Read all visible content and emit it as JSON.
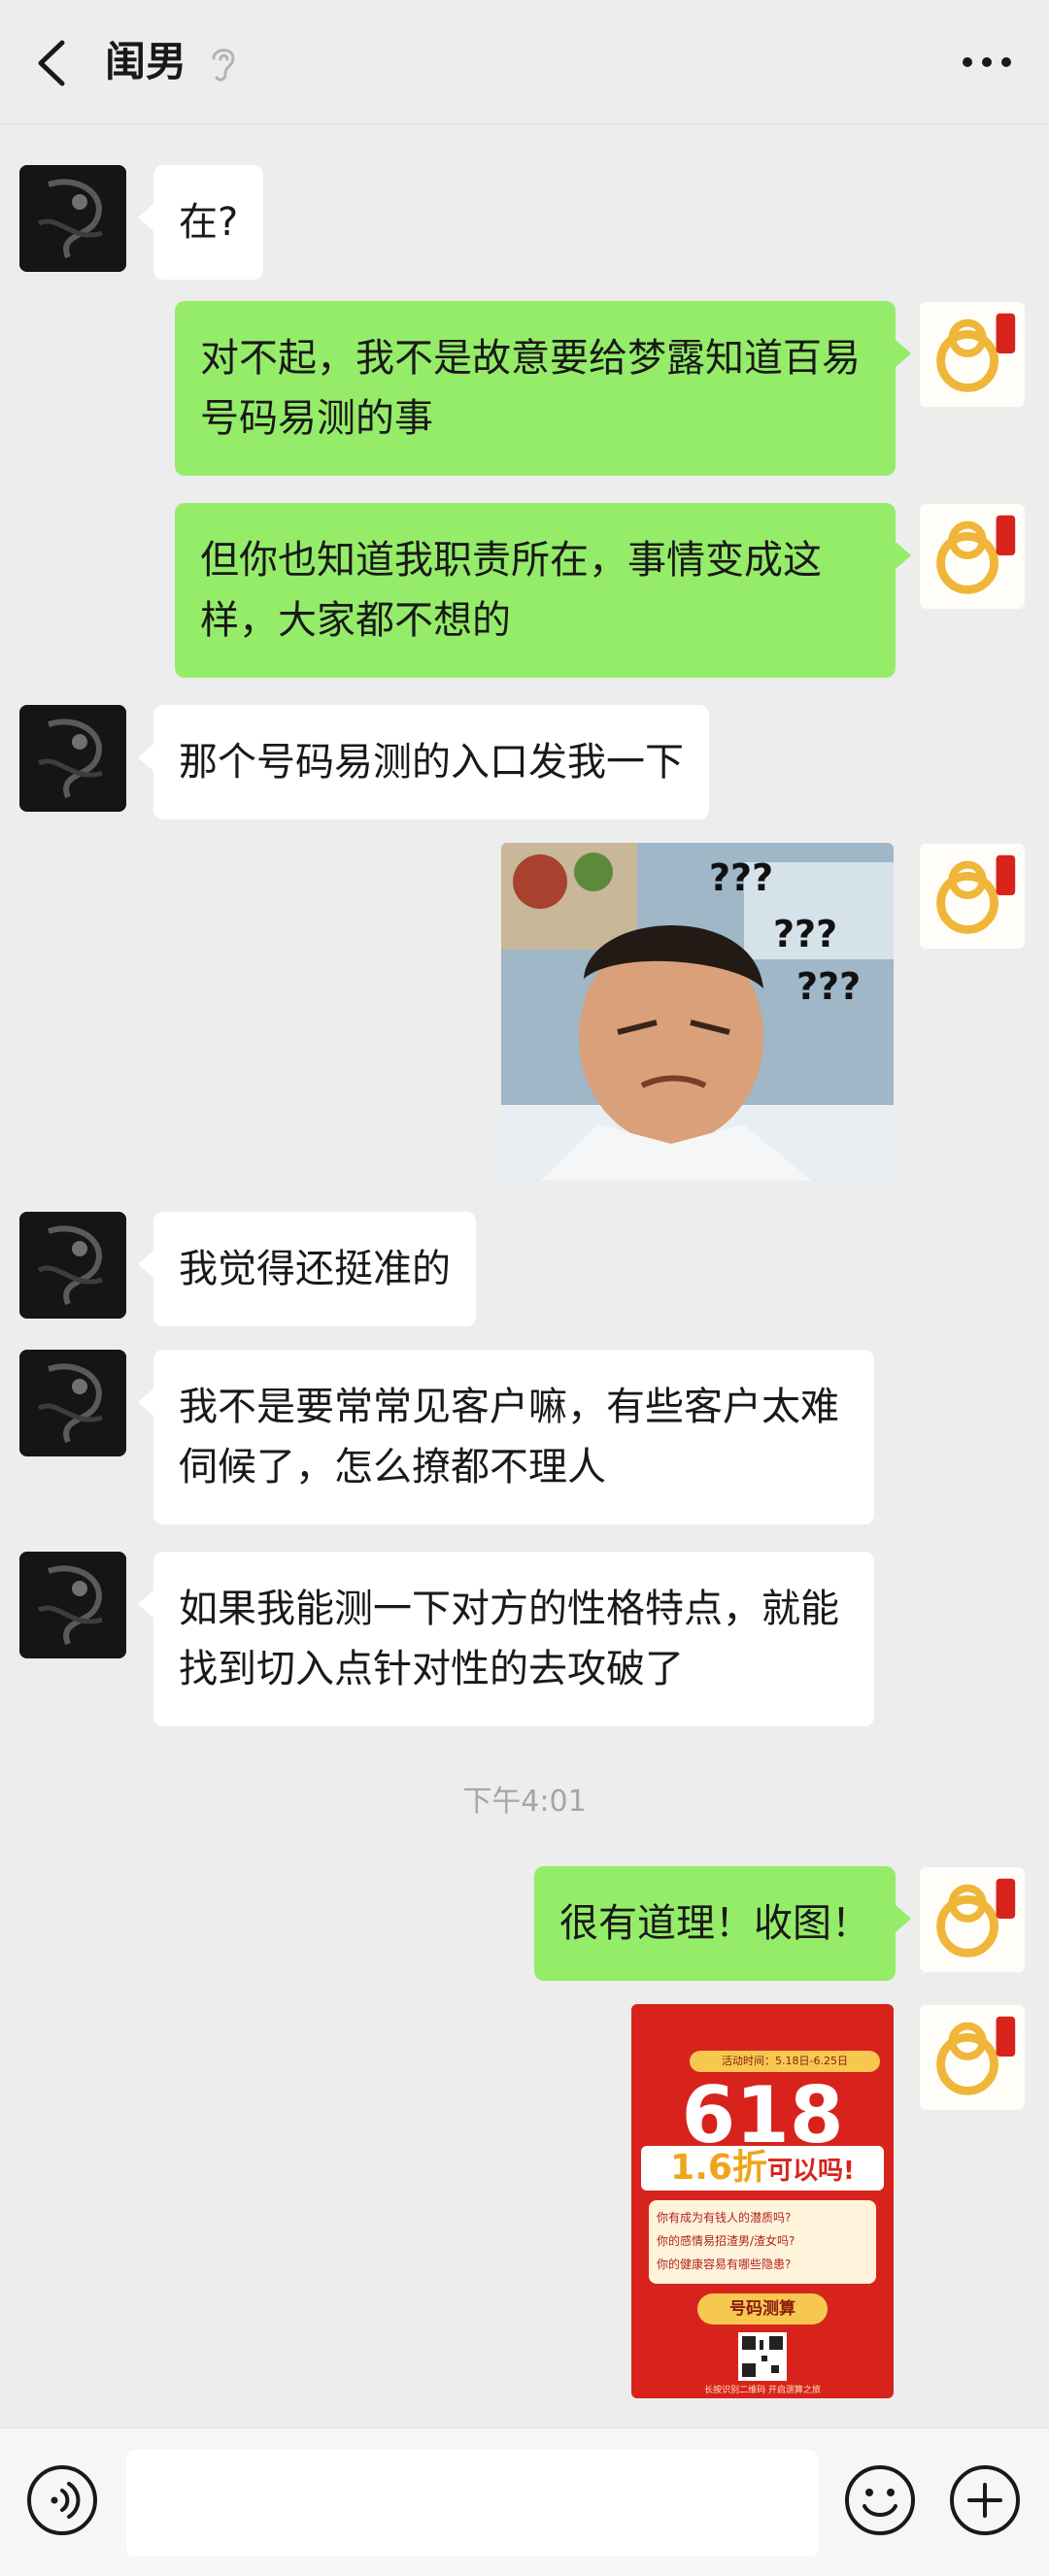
{
  "header": {
    "title": "闺男",
    "back_icon": "chevron-left-icon",
    "ear_icon": "ear-icon",
    "more_icon": "more-dots-icon"
  },
  "messages": [
    {
      "side": "left",
      "type": "text",
      "text": "在?"
    },
    {
      "side": "right",
      "type": "text",
      "text": "对不起，我不是故意要给梦露知道百易号码易测的事"
    },
    {
      "side": "right",
      "type": "text",
      "text": "但你也知道我职责所在，事情变成这样，大家都不想的"
    },
    {
      "side": "left",
      "type": "text",
      "text": "那个号码易测的入口发我一下"
    },
    {
      "side": "right",
      "type": "image",
      "overlay_text": [
        "???",
        "???",
        "???"
      ]
    },
    {
      "side": "left",
      "type": "text",
      "text": "我觉得还挺准的"
    },
    {
      "side": "left",
      "type": "text",
      "text": "我不是要常常见客户嘛，有些客户太难伺候了，怎么撩都不理人"
    },
    {
      "side": "left",
      "type": "text",
      "text": "如果我能测一下对方的性格特点，就能找到切入点针对性的去攻破了"
    },
    {
      "side": "right",
      "type": "text",
      "text": "很有道理！收图！"
    },
    {
      "side": "right",
      "type": "poster",
      "poster": {
        "top_label": "活动时间：5.18日-6.25日",
        "big_number": "618",
        "discount": "1.6折",
        "discount_suffix": "可以吗!",
        "lines": [
          "你有成为有钱人的潜质吗?",
          "你的感情易招渣男/渣女吗?",
          "你的健康容易有哪些隐患?"
        ],
        "button": "号码测算",
        "footer": "长按识别二维码 开启测算之旅"
      }
    }
  ],
  "timestamp": "下午4:01",
  "input_bar": {
    "voice_icon": "voice-icon",
    "emoji_icon": "emoji-icon",
    "plus_icon": "plus-icon",
    "input_value": ""
  },
  "colors": {
    "background": "#ededed",
    "bubble_self": "#95ec69",
    "bubble_other": "#ffffff",
    "poster_red": "#d8231c",
    "poster_gold": "#f6c850"
  }
}
